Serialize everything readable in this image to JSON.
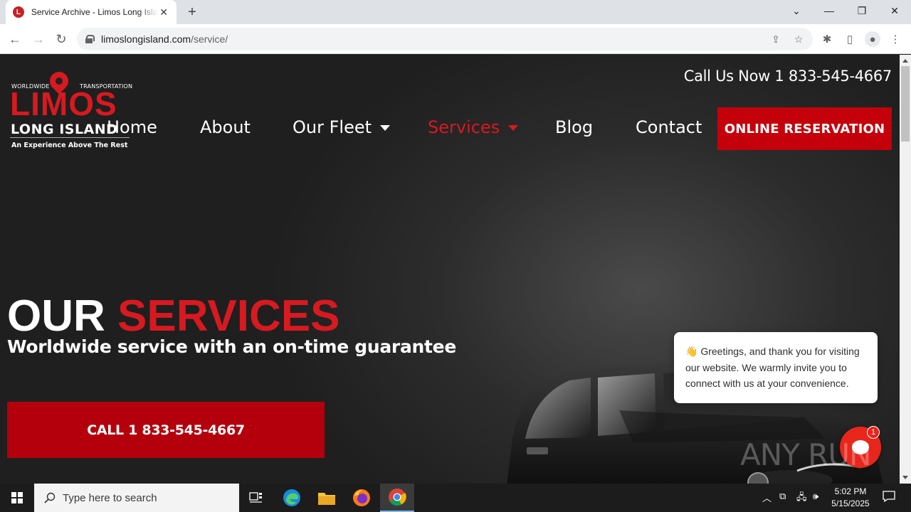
{
  "browser": {
    "tab": {
      "title": "Service Archive - Limos Long Island",
      "favicon_letter": "L"
    },
    "url": {
      "host": "limoslongisland.com",
      "path": "/service/"
    }
  },
  "site": {
    "call_us": "Call Us Now 1 833-545-4667",
    "logo": {
      "top_left": "WORLDWIDE",
      "top_right": "TRANSPORTATION",
      "name": "LIMOS",
      "subname": "LONG ISLAND",
      "tagline": "An Experience Above The Rest"
    },
    "nav": {
      "home": "Home",
      "about": "About",
      "fleet": "Our Fleet",
      "services": "Services",
      "blog": "Blog",
      "contact": "Contact",
      "reservation": "ONLINE RESERVATION"
    },
    "hero": {
      "title_white": "OUR",
      "title_red": "SERVICES",
      "subtitle": "Worldwide service with an on-time guarantee",
      "call_button": "CALL 1 833-545-4667"
    },
    "chat": {
      "emoji": "👋",
      "message": "Greetings, and thank you for visiting our website. We warmly invite you to connect with us at your convenience.",
      "badge": "1"
    },
    "watermark": "ANY RUN"
  },
  "taskbar": {
    "search_placeholder": "Type here to search",
    "time": "5:02 PM",
    "date": "5/15/2025"
  },
  "colors": {
    "brand_red": "#d71920",
    "button_red": "#c4000a",
    "page_dark": "#2c2c2c"
  }
}
